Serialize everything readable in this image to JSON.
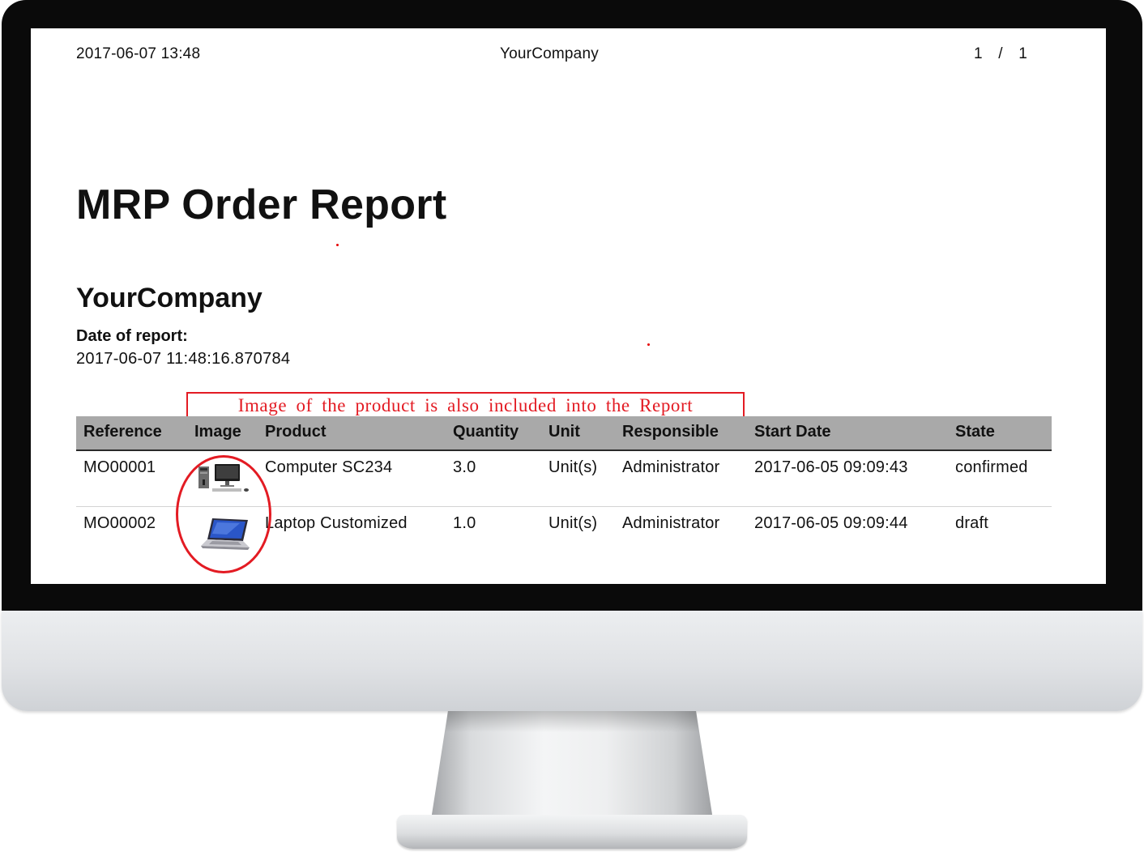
{
  "page_header": {
    "datetime": "2017-06-07 13:48",
    "company": "YourCompany",
    "page_indicator": "1 / 1"
  },
  "report": {
    "title": "MRP Order Report",
    "company": "YourCompany",
    "date_label": "Date of report:",
    "date_value": "2017-06-07 11:48:16.870784"
  },
  "annotation": {
    "callout_text": "Image of the product is also included into the Report",
    "color": "#e31b23"
  },
  "table": {
    "columns": [
      "Reference",
      "Image",
      "Product",
      "Quantity",
      "Unit",
      "Responsible",
      "Start Date",
      "State"
    ],
    "rows": [
      {
        "reference": "MO00001",
        "image_icon": "desktop-computer-icon",
        "product": "Computer SC234",
        "quantity": "3.0",
        "unit": "Unit(s)",
        "responsible": "Administrator",
        "start_date": "2017-06-05 09:09:43",
        "state": "confirmed"
      },
      {
        "reference": "MO00002",
        "image_icon": "laptop-icon",
        "product": "Laptop Customized",
        "quantity": "1.0",
        "unit": "Unit(s)",
        "responsible": "Administrator",
        "start_date": "2017-06-05 09:09:44",
        "state": "draft"
      }
    ],
    "header_background": "#a9a9a9"
  }
}
